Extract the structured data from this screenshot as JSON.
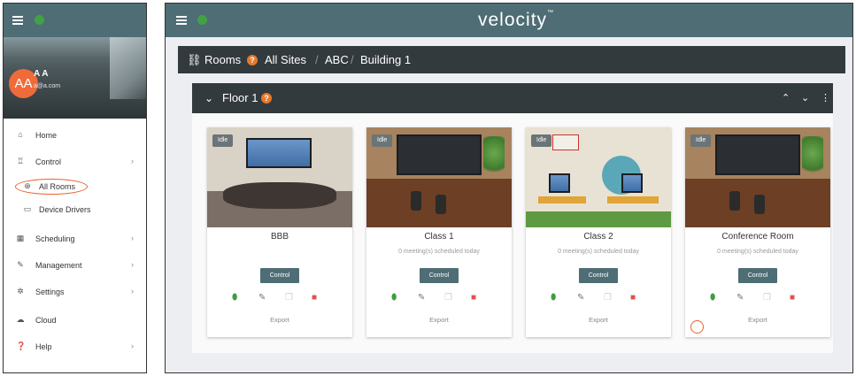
{
  "colors": {
    "topbar": "#4e6d75",
    "accent_orange": "#e8622a",
    "avatar_bg": "#ef6b3a",
    "dark_bar": "#333a3d",
    "delete_red": "#e05050",
    "plug_green": "#3f9e3f",
    "globe_green": "#43a047"
  },
  "sidebar": {
    "avatar_initials": "AA",
    "username": "A A",
    "email": "a@a.com",
    "menu": [
      {
        "label": "Home",
        "icon": "home-icon",
        "chevron": false
      },
      {
        "label": "Control",
        "icon": "control-icon",
        "chevron": true
      },
      {
        "label": "All Rooms",
        "icon": "globe-icon",
        "chevron": false
      },
      {
        "label": "Device Drivers",
        "icon": "device-icon",
        "chevron": false
      },
      {
        "label": "Scheduling",
        "icon": "calendar-icon",
        "chevron": true
      },
      {
        "label": "Management",
        "icon": "wrench-icon",
        "chevron": true
      },
      {
        "label": "Settings",
        "icon": "gear-icon",
        "chevron": true
      },
      {
        "label": "Cloud",
        "icon": "cloud-icon",
        "chevron": false
      },
      {
        "label": "Help",
        "icon": "help-icon",
        "chevron": true
      }
    ]
  },
  "main": {
    "brand": "velocity",
    "breadcrumb": {
      "root": "Rooms",
      "items": [
        "All Sites",
        "ABC",
        "Building 1"
      ],
      "separator": "/"
    },
    "floor": {
      "title": "Floor 1",
      "help": "?"
    },
    "cards": [
      {
        "name": "BBB",
        "status": "Idle",
        "meetings": "",
        "control": "Control",
        "export": "Export"
      },
      {
        "name": "Class 1",
        "status": "Idle",
        "meetings": "0 meeting(s) scheduled today",
        "control": "Control",
        "export": "Export"
      },
      {
        "name": "Class 2",
        "status": "Idle",
        "meetings": "0 meeting(s) scheduled today",
        "control": "Control",
        "export": "Export"
      },
      {
        "name": "Conference Room",
        "status": "Idle",
        "meetings": "0 meeting(s) scheduled today",
        "control": "Control",
        "export": "Export"
      }
    ]
  }
}
